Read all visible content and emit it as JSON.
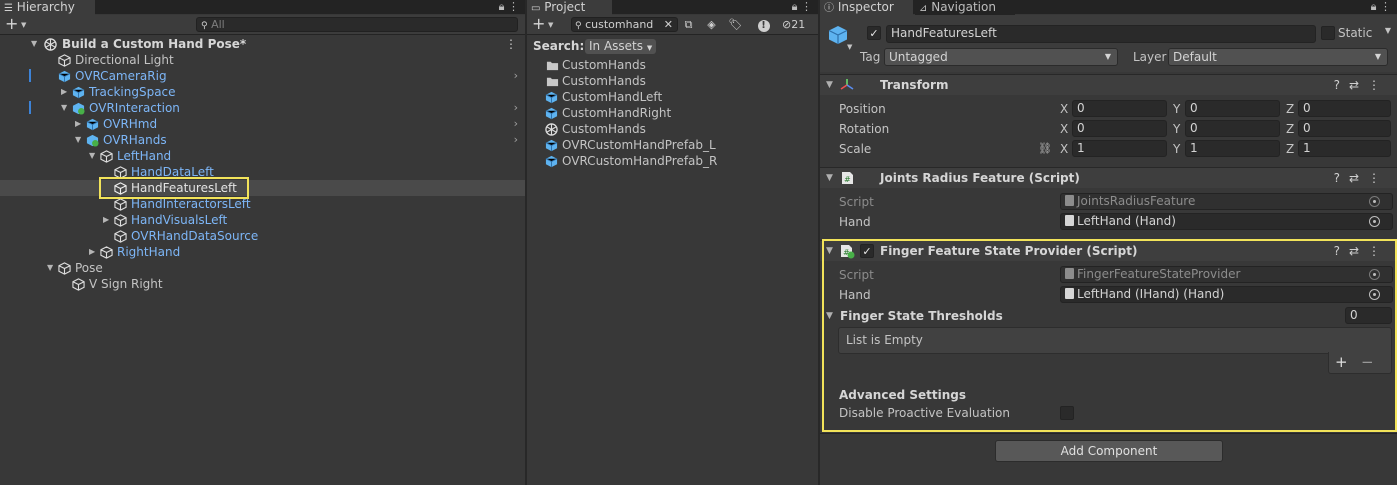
{
  "hierarchy": {
    "tab": "Hierarchy",
    "search_placeholder": "All",
    "rows": [
      {
        "label": "Build a Custom Hand Pose*",
        "style": "scene"
      },
      {
        "label": "Directional Light",
        "style": "normal"
      },
      {
        "label": "OVRCameraRig",
        "style": "blue"
      },
      {
        "label": "TrackingSpace",
        "style": "blue"
      },
      {
        "label": "OVRInteraction",
        "style": "blue"
      },
      {
        "label": "OVRHmd",
        "style": "blue"
      },
      {
        "label": "OVRHands",
        "style": "blue"
      },
      {
        "label": "LeftHand",
        "style": "blue"
      },
      {
        "label": "HandDataLeft",
        "style": "blue"
      },
      {
        "label": "HandFeaturesLeft",
        "style": "selected"
      },
      {
        "label": "HandInteractorsLeft",
        "style": "blue"
      },
      {
        "label": "HandVisualsLeft",
        "style": "blue"
      },
      {
        "label": "OVRHandDataSource",
        "style": "blue"
      },
      {
        "label": "RightHand",
        "style": "blue"
      },
      {
        "label": "Pose",
        "style": "normal"
      },
      {
        "label": "V Sign Right",
        "style": "normal"
      }
    ]
  },
  "project": {
    "tab": "Project",
    "search_value": "customhand",
    "hidden_count": "21",
    "search_label": "Search:",
    "scope": "In Assets",
    "items": [
      {
        "label": "CustomHands",
        "icon": "folder-icon"
      },
      {
        "label": "CustomHands",
        "icon": "folder-icon"
      },
      {
        "label": "CustomHandLeft",
        "icon": "prefab-icon"
      },
      {
        "label": "CustomHandRight",
        "icon": "prefab-icon"
      },
      {
        "label": "CustomHands",
        "icon": "unity-scene-icon"
      },
      {
        "label": "OVRCustomHandPrefab_L",
        "icon": "prefab-icon"
      },
      {
        "label": "OVRCustomHandPrefab_R",
        "icon": "prefab-icon"
      }
    ]
  },
  "inspector": {
    "tab_inspector": "Inspector",
    "tab_navigation": "Navigation",
    "object_name": "HandFeaturesLeft",
    "static_label": "Static",
    "tag_label": "Tag",
    "tag_value": "Untagged",
    "layer_label": "Layer",
    "layer_value": "Default",
    "transform": {
      "title": "Transform",
      "position_label": "Position",
      "rotation_label": "Rotation",
      "scale_label": "Scale",
      "axis_x": "X",
      "axis_y": "Y",
      "axis_z": "Z",
      "position": [
        "0",
        "0",
        "0"
      ],
      "rotation": [
        "0",
        "0",
        "0"
      ],
      "scale": [
        "1",
        "1",
        "1"
      ]
    },
    "joints_radius": {
      "title": "Joints Radius Feature (Script)",
      "script_label": "Script",
      "script_value": "JointsRadiusFeature",
      "hand_label": "Hand",
      "hand_value": "LeftHand (Hand)"
    },
    "finger_feature": {
      "title": "Finger Feature State Provider (Script)",
      "script_label": "Script",
      "script_value": "FingerFeatureStateProvider",
      "hand_label": "Hand",
      "hand_value": "LeftHand (IHand) (Hand)",
      "thresholds_label": "Finger State Thresholds",
      "thresholds_count": "0",
      "list_empty": "List is Empty",
      "add_symbol": "+",
      "remove_symbol": "−",
      "advanced_label": "Advanced Settings",
      "disable_label": "Disable Proactive Evaluation"
    },
    "add_component": "Add Component"
  },
  "colors": {
    "highlight": "#f2e35a",
    "link_blue": "#7db6f7",
    "selection": "#4a4a4a"
  }
}
